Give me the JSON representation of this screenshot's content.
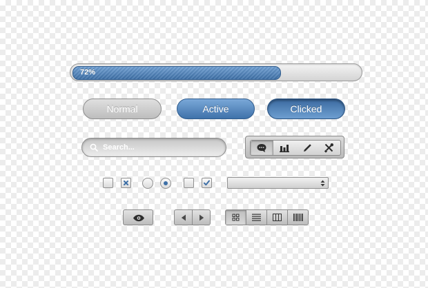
{
  "progress": {
    "label": "72%",
    "value": 0.72,
    "fill_color": "#4f81b8"
  },
  "buttons": {
    "normal": "Normal",
    "active": "Active",
    "clicked": "Clicked"
  },
  "search": {
    "placeholder": "Search..."
  },
  "toolbar": {
    "items": [
      {
        "icon": "speech-bubble-icon",
        "selected": true
      },
      {
        "icon": "bar-chart-icon",
        "selected": false
      },
      {
        "icon": "pen-icon",
        "selected": false
      },
      {
        "icon": "tools-icon",
        "selected": false
      }
    ]
  },
  "controls": {
    "checkbox_states": [
      "unchecked",
      "crossed",
      "unchecked",
      "checked"
    ],
    "radio_states": [
      "unselected",
      "selected"
    ],
    "select_value": ""
  },
  "bottom": {
    "eye": "eye-icon",
    "nav": [
      "prev-arrow-icon",
      "next-arrow-icon"
    ],
    "views": [
      "grid-icon",
      "list-icon",
      "columns-icon",
      "barcode-icon"
    ]
  },
  "colors": {
    "accent": "#4f81b8",
    "accent_dark": "#2f5b8c"
  }
}
